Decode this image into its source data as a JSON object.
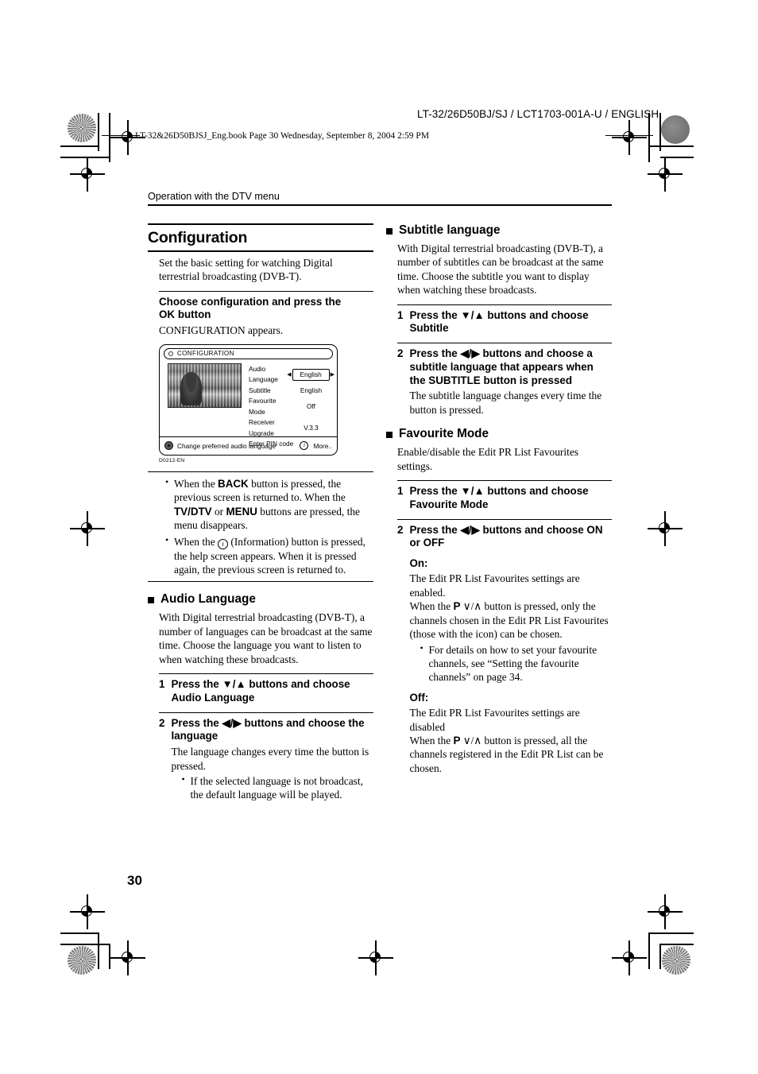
{
  "print_marks": {
    "doc_code": "LT-32/26D50BJ/SJ / LCT1703-001A-U / ENGLISH",
    "file_bar": "LT-32&26D50BJSJ_Eng.book  Page 30  Wednesday, September 8, 2004  2:59 PM"
  },
  "running_head": "Operation with the DTV menu",
  "page_number": "30",
  "left_column": {
    "section_title": "Configuration",
    "intro": "Set the basic setting for watching Digital terrestrial broadcasting (DVB-T).",
    "choose_head_line1": "Choose configuration and press the",
    "choose_head_ok": "OK",
    "choose_head_line2": " button",
    "choose_body": "CONFIGURATION appears.",
    "figure": {
      "title": "CONFIGURATION",
      "rows": [
        {
          "label": "Audio Language",
          "value": "English",
          "selected": true
        },
        {
          "label": "Subtitle",
          "value": "English",
          "selected": false
        },
        {
          "label": "Favourite Mode",
          "value": "Off",
          "selected": false
        },
        {
          "label": "Receiver Upgrade",
          "value": "V.3.3",
          "selected": false
        },
        {
          "label": "Enter PIN code",
          "value": "",
          "selected": false
        }
      ],
      "footer_hint": "Change preferred audio language",
      "footer_more": "More..",
      "figure_code": "D0212-EN"
    },
    "notes": [
      "When the BACK button is pressed, the previous screen is returned to. When the TV/DTV or MENU buttons are pressed, the menu disappears.",
      "When the ⓘ (Information) button is pressed, the help screen appears. When it is pressed again, the previous screen is returned to."
    ],
    "note1_parts": {
      "a": "When the ",
      "b": "BACK",
      "c": " button is pressed, the previous screen is returned to. When the ",
      "d": "TV/DTV",
      "e": " or ",
      "f": "MENU",
      "g": " buttons are pressed, the menu disappears."
    },
    "note2_parts": {
      "a": "When the ",
      "b": "i",
      "c": " (Information) button is pressed, the help screen appears. When it is pressed again, the previous screen is returned to."
    },
    "topic": {
      "title": "Audio Language",
      "body": "With Digital terrestrial broadcasting (DVB-T), a number of languages can be broadcast at the same time. Choose the language you want to listen to when watching these broadcasts.",
      "steps": [
        {
          "num": "1",
          "text": "Press the ▼/▲ buttons and choose Audio Language",
          "body": "",
          "bullets": []
        },
        {
          "num": "2",
          "text": "Press the ◀/▶ buttons and choose the language",
          "body": "The language changes every time the button is pressed.",
          "bullets": [
            "If the selected language is not broadcast, the default language will be played."
          ]
        }
      ]
    }
  },
  "right_column": {
    "topics": [
      {
        "title": "Subtitle language",
        "body": "With Digital terrestrial broadcasting (DVB-T), a number of subtitles can be broadcast at the same time. Choose the subtitle you want to display when watching these broadcasts.",
        "steps": [
          {
            "num": "1",
            "text": "Press the ▼/▲ buttons and choose Subtitle",
            "body": "",
            "bullets": []
          },
          {
            "num": "2",
            "text": "Press the ◀/▶ buttons and choose a subtitle language that appears when the SUBTITLE button is pressed",
            "body": "The subtitle language changes every time the button is pressed.",
            "bullets": []
          }
        ]
      },
      {
        "title": "Favourite Mode",
        "body": "Enable/disable the Edit PR List Favourites settings.",
        "steps": [
          {
            "num": "1",
            "text": "Press the ▼/▲ buttons and choose Favourite Mode",
            "body": "",
            "bullets": []
          },
          {
            "num": "2",
            "text": "Press the ◀/▶ buttons and choose ON or OFF",
            "body": "",
            "bullets": []
          }
        ]
      }
    ],
    "on_label": "On:",
    "on_body_1": "The Edit PR List Favourites settings are enabled.",
    "on_body_2_a": "When the ",
    "on_body_2_p": "P",
    "on_body_2_updown": " ∨/∧ ",
    "on_body_2_b": "button is pressed, only the channels chosen in the Edit PR List Favourites (those with the icon) can be chosen.",
    "on_bullet": "For details on how to set your favourite channels, see “Setting the favourite channels” on page 34.",
    "off_label": "Off:",
    "off_body_1": "The Edit PR List Favourites settings are disabled",
    "off_body_2_a": "When the ",
    "off_body_2_p": "P",
    "off_body_2_updown": " ∨/∧ ",
    "off_body_2_b": "button is pressed, all the channels registered in the Edit PR List can be chosen."
  }
}
